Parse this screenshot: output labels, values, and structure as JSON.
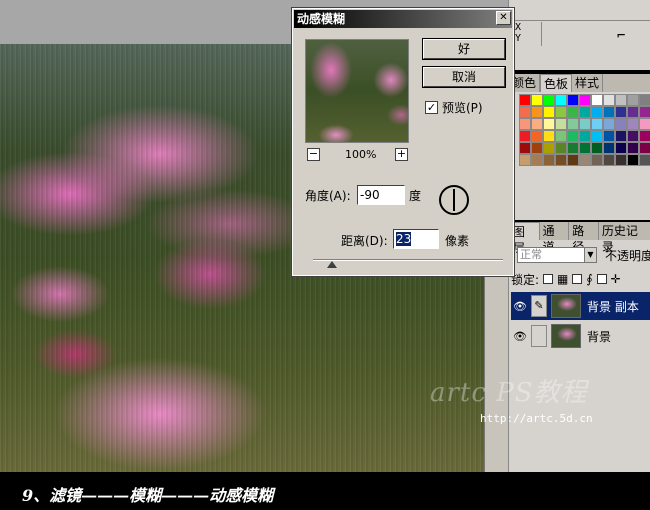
{
  "info_panel": {
    "xy_label_1": "X\nY",
    "xy_label_2": "X\nY"
  },
  "colors_panel": {
    "tabs": [
      "颜色",
      "色板",
      "样式"
    ],
    "active_tab": "色板",
    "swatch_colors": [
      "#ff0000",
      "#ffff00",
      "#00ff00",
      "#00ffff",
      "#0000ff",
      "#ff00ff",
      "#ffffff",
      "#e0e0e0",
      "#c0c0c0",
      "#a0a0a0",
      "#808080",
      "#f26c4f",
      "#f8941d",
      "#fff200",
      "#8dc63f",
      "#39b54a",
      "#00a99d",
      "#00aeef",
      "#0072bc",
      "#2e3192",
      "#662d91",
      "#92278f",
      "#f7977a",
      "#fbad82",
      "#fff799",
      "#c4df9b",
      "#82ca9c",
      "#7accc8",
      "#6dcff6",
      "#7da7d9",
      "#8781bd",
      "#a186be",
      "#f49ac1",
      "#ed1c24",
      "#f26522",
      "#ffde17",
      "#7cc576",
      "#1cbb62",
      "#00a99d",
      "#00bff3",
      "#0054a6",
      "#1b1464",
      "#440e62",
      "#9e005d",
      "#9e0b0f",
      "#a0410d",
      "#aba000",
      "#598527",
      "#197b30",
      "#007236",
      "#005e20",
      "#003471",
      "#0d004c",
      "#32004b",
      "#7b0046",
      "#c69c6d",
      "#a67c52",
      "#8c6239",
      "#754c24",
      "#603913",
      "#998675",
      "#736357",
      "#534741",
      "#362f2d",
      "#000000",
      "#555555"
    ]
  },
  "layers_panel": {
    "tabs": [
      "图层",
      "通道",
      "路径",
      "历史记录"
    ],
    "blend_mode": "正常",
    "opacity_label": "不透明度:",
    "lock_label": "锁定:",
    "layers": [
      {
        "name": "背景 副本",
        "selected": true
      },
      {
        "name": "背景",
        "selected": false
      }
    ]
  },
  "dialog": {
    "title": "动感模糊",
    "ok_label": "好",
    "cancel_label": "取消",
    "preview_label": "预览(P)",
    "preview_checked": true,
    "zoom_value": "100%",
    "zoom_minus": "−",
    "zoom_plus": "+",
    "angle_label": "角度(A):",
    "angle_value": "-90",
    "angle_unit": "度",
    "distance_label": "距离(D):",
    "distance_value": "23",
    "distance_unit": "像素",
    "close_glyph": "✕"
  },
  "watermark": {
    "logo_text": "artc PS教程",
    "url": "http://artc.5d.cn"
  },
  "caption": "9、滤镜———模糊———动感模糊"
}
